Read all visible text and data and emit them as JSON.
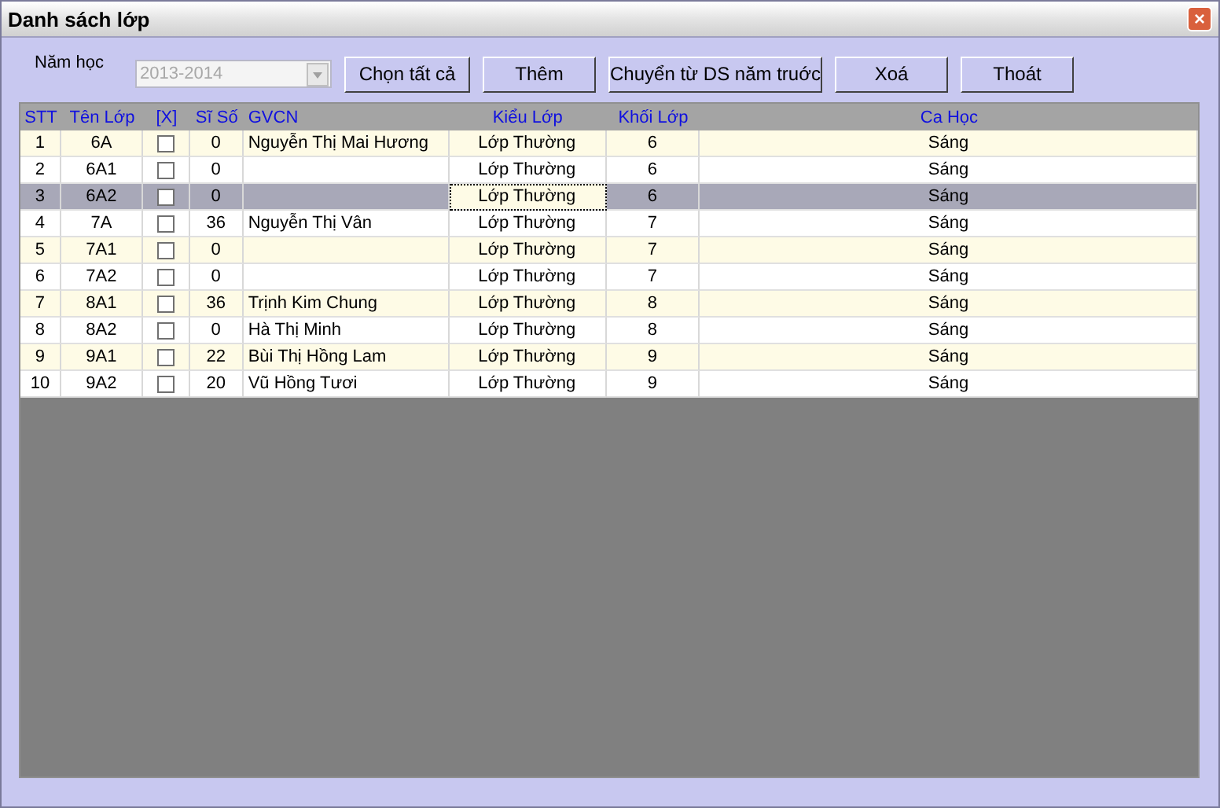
{
  "window": {
    "title": "Danh sách lớp",
    "close_button": "×"
  },
  "year": {
    "label": "Năm học",
    "value": "2013-2014",
    "disabled": true
  },
  "buttons": [
    "Chọn tất cả",
    "Thêm",
    "Chuyển từ DS năm truớc",
    "Xoá",
    "Thoát"
  ],
  "table": {
    "columns": [
      "STT",
      "Tên Lớp",
      "[X]",
      "Sĩ Số",
      "GVCN",
      "Kiểu Lớp",
      "Khối Lớp",
      "Ca Học"
    ],
    "rows": [
      {
        "stt": "1",
        "name": "6A",
        "checked": false,
        "size": "0",
        "teacher": "Nguyễn Thị Mai Hương",
        "type": "Lớp Thường",
        "grade": "6",
        "shift": "Sáng",
        "selected": false
      },
      {
        "stt": "2",
        "name": "6A1",
        "checked": false,
        "size": "0",
        "teacher": "",
        "type": "Lớp Thường",
        "grade": "6",
        "shift": "Sáng",
        "selected": false
      },
      {
        "stt": "3",
        "name": "6A2",
        "checked": false,
        "size": "0",
        "teacher": "",
        "type": "Lớp Thường",
        "grade": "6",
        "shift": "Sáng",
        "selected": true
      },
      {
        "stt": "4",
        "name": "7A",
        "checked": false,
        "size": "36",
        "teacher": "Nguyễn Thị Vân",
        "type": "Lớp Thường",
        "grade": "7",
        "shift": "Sáng",
        "selected": false
      },
      {
        "stt": "5",
        "name": "7A1",
        "checked": false,
        "size": "0",
        "teacher": "",
        "type": "Lớp Thường",
        "grade": "7",
        "shift": "Sáng",
        "selected": false
      },
      {
        "stt": "6",
        "name": "7A2",
        "checked": false,
        "size": "0",
        "teacher": "",
        "type": "Lớp Thường",
        "grade": "7",
        "shift": "Sáng",
        "selected": false
      },
      {
        "stt": "7",
        "name": "8A1",
        "checked": false,
        "size": "36",
        "teacher": "Trịnh Kim Chung",
        "type": "Lớp Thường",
        "grade": "8",
        "shift": "Sáng",
        "selected": false
      },
      {
        "stt": "8",
        "name": "8A2",
        "checked": false,
        "size": "0",
        "teacher": "Hà Thị Minh",
        "type": "Lớp Thường",
        "grade": "8",
        "shift": "Sáng",
        "selected": false
      },
      {
        "stt": "9",
        "name": "9A1",
        "checked": false,
        "size": "22",
        "teacher": "Bùi Thị Hồng Lam",
        "type": "Lớp Thường",
        "grade": "9",
        "shift": "Sáng",
        "selected": false
      },
      {
        "stt": "10",
        "name": "9A2",
        "checked": false,
        "size": "20",
        "teacher": "Vũ Hồng Tươi",
        "type": "Lớp Thường",
        "grade": "9",
        "shift": "Sáng",
        "selected": false
      }
    ]
  }
}
